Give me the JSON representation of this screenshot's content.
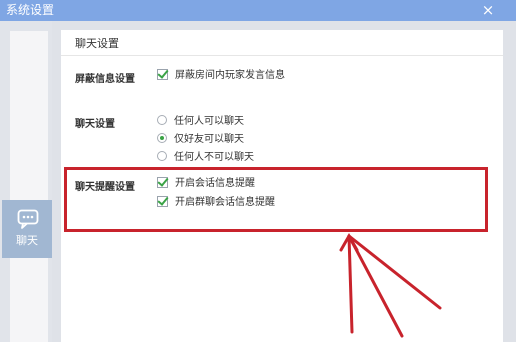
{
  "window": {
    "title": "系统设置",
    "close_symbol": "×"
  },
  "sidebar": {
    "items": [
      {
        "label": "聊天",
        "icon": "chat-bubble-icon",
        "active": true
      }
    ]
  },
  "main": {
    "title": "聊天设置",
    "sections": {
      "block_info": {
        "label": "屏蔽信息设置",
        "options": [
          {
            "label": "屏蔽房间内玩家发言信息",
            "checked": true
          }
        ]
      },
      "chat": {
        "label": "聊天设置",
        "options": [
          {
            "label": "任何人可以聊天",
            "selected": false
          },
          {
            "label": "仅好友可以聊天",
            "selected": true
          },
          {
            "label": "任何人不可以聊天",
            "selected": false
          }
        ]
      },
      "chat_reminder": {
        "label": "聊天提醒设置",
        "options": [
          {
            "label": "开启会话信息提醒",
            "checked": true
          },
          {
            "label": "开启群聊会话信息提醒",
            "checked": true
          }
        ]
      }
    }
  },
  "colors": {
    "titlebar": "#7fa6e4",
    "sidebar_active": "#a1b7d2",
    "checkmark": "#3aa346",
    "annotation": "#c8232c"
  }
}
